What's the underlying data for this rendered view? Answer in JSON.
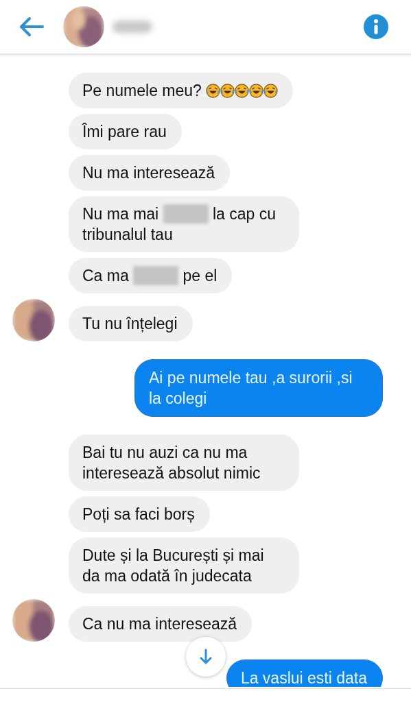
{
  "header": {
    "contact_name_blurred": true
  },
  "messages": [
    {
      "kind": "incoming",
      "avatar": false,
      "parts": [
        {
          "kind": "text",
          "text": "Pe numele meu? "
        },
        {
          "kind": "emoji"
        },
        {
          "kind": "emoji"
        },
        {
          "kind": "emoji"
        },
        {
          "kind": "emoji"
        },
        {
          "kind": "emoji"
        }
      ]
    },
    {
      "kind": "incoming",
      "avatar": false,
      "parts": [
        {
          "kind": "text",
          "text": "Îmi pare rau"
        }
      ]
    },
    {
      "kind": "incoming",
      "avatar": false,
      "parts": [
        {
          "kind": "text",
          "text": "Nu ma interesează"
        }
      ]
    },
    {
      "kind": "incoming",
      "avatar": false,
      "parts": [
        {
          "kind": "text",
          "text": "Nu ma mai "
        },
        {
          "kind": "redacted"
        },
        {
          "kind": "text",
          "text": " la cap cu tribunalul tau"
        }
      ]
    },
    {
      "kind": "incoming",
      "avatar": false,
      "parts": [
        {
          "kind": "text",
          "text": "Ca ma "
        },
        {
          "kind": "redacted"
        },
        {
          "kind": "text",
          "text": " pe el"
        }
      ]
    },
    {
      "kind": "incoming",
      "avatar": true,
      "parts": [
        {
          "kind": "text",
          "text": "Tu nu înțelegi"
        }
      ]
    },
    {
      "kind": "outgoing",
      "avatar": false,
      "parts": [
        {
          "kind": "text",
          "text": "Ai pe numele tau ,a surorii ,si la colegi"
        }
      ]
    },
    {
      "kind": "incoming",
      "avatar": false,
      "parts": [
        {
          "kind": "text",
          "text": "Bai tu nu auzi ca nu ma interesează absolut nimic"
        }
      ]
    },
    {
      "kind": "incoming",
      "avatar": false,
      "parts": [
        {
          "kind": "text",
          "text": "Poți sa faci borș"
        }
      ]
    },
    {
      "kind": "incoming",
      "avatar": false,
      "parts": [
        {
          "kind": "text",
          "text": "Dute și la București și mai da ma odată în judecata"
        }
      ]
    },
    {
      "kind": "incoming",
      "avatar": true,
      "parts": [
        {
          "kind": "text",
          "text": "Ca nu ma interesează"
        }
      ]
    },
    {
      "kind": "outgoing",
      "avatar": false,
      "parts": [
        {
          "kind": "text",
          "text": "La vaslui esti data"
        }
      ]
    }
  ]
}
